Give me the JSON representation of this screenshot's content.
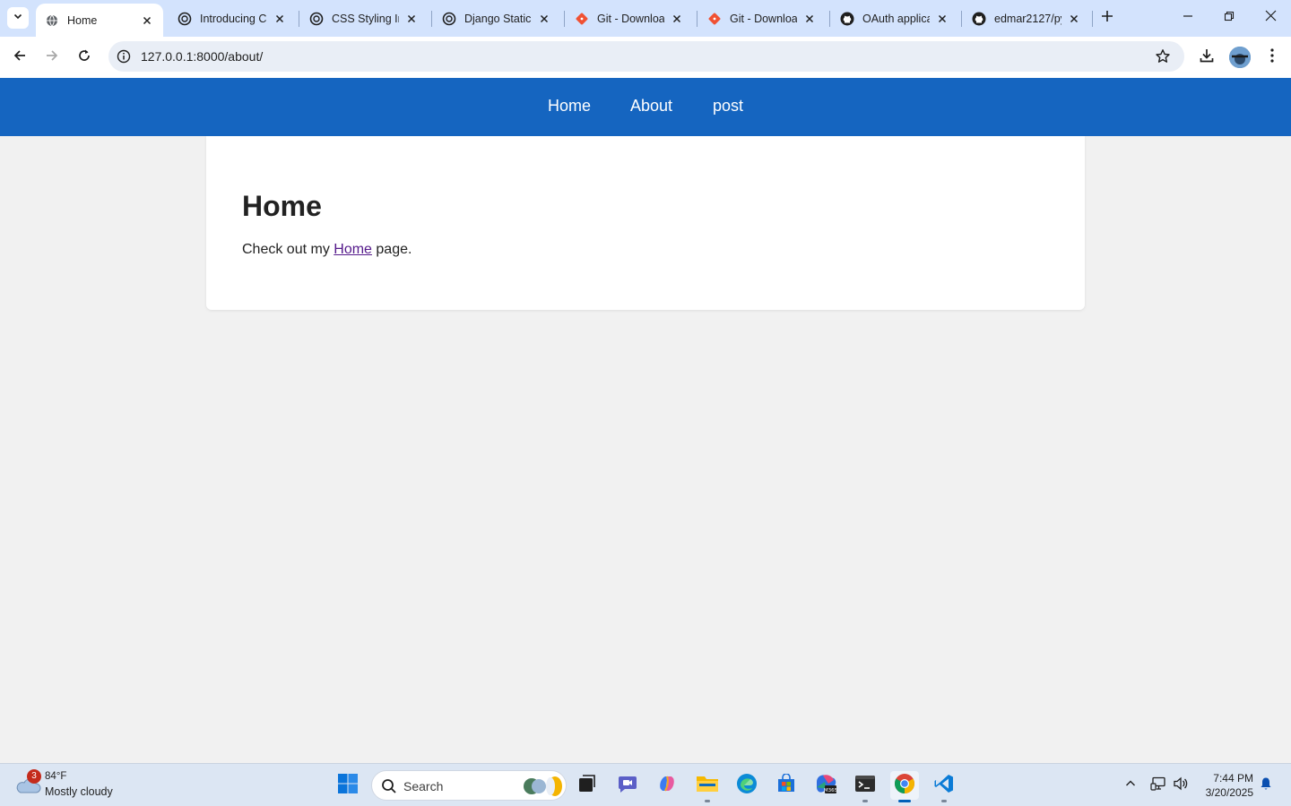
{
  "browser": {
    "tabs": [
      {
        "label": "Home",
        "favicon": "globe-icon",
        "active": true
      },
      {
        "label": "Introducing Ch",
        "favicon": "openai-icon",
        "active": false
      },
      {
        "label": "CSS Styling Im",
        "favicon": "openai-icon",
        "active": false
      },
      {
        "label": "Django Static",
        "favicon": "openai-icon",
        "active": false
      },
      {
        "label": "Git - Downloa",
        "favicon": "git-icon",
        "active": false
      },
      {
        "label": "Git - Downloa",
        "favicon": "git-icon",
        "active": false
      },
      {
        "label": "OAuth applica",
        "favicon": "github-icon",
        "active": false
      },
      {
        "label": "edmar2127/py",
        "favicon": "github-icon",
        "active": false
      }
    ],
    "url": "127.0.0.1:8000/about/"
  },
  "site": {
    "nav": [
      {
        "label": "Home"
      },
      {
        "label": "About"
      },
      {
        "label": "post"
      }
    ],
    "heading": "Home",
    "body_prefix": "Check out my",
    "body_link": "Home",
    "body_suffix": "page."
  },
  "taskbar": {
    "weather": {
      "badge": "3",
      "temp": "84°F",
      "desc": "Mostly cloudy"
    },
    "search_placeholder": "Search",
    "apps": [
      "start-icon",
      "task-view-icon",
      "teams-icon",
      "copilot-icon",
      "file-explorer-icon",
      "edge-icon",
      "store-icon",
      "m365-icon",
      "terminal-icon",
      "chrome-icon",
      "vscode-icon"
    ],
    "clock": {
      "time": "7:44 PM",
      "date": "3/20/2025"
    }
  },
  "colors": {
    "site_nav": "#1565c0",
    "tabstrip": "#d3e3fd",
    "link_visited": "#551a8b"
  }
}
